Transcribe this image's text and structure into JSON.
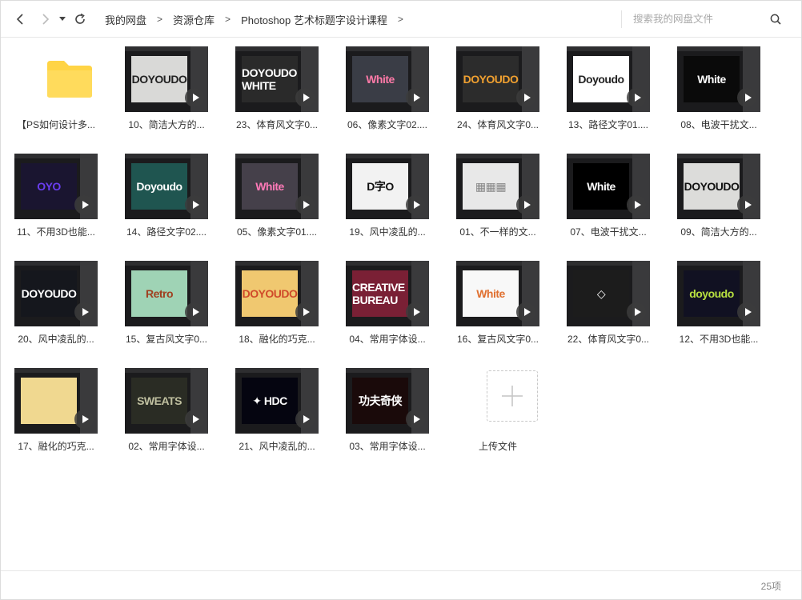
{
  "toolbar": {
    "back_icon": "chevron-left-icon",
    "forward_icon": "chevron-right-icon",
    "history_icon": "caret-down-icon",
    "refresh_icon": "refresh-icon",
    "breadcrumbs": [
      "我的网盘",
      "资源仓库",
      "Photoshop 艺术标题字设计课程"
    ],
    "separator": ">",
    "search_placeholder": "搜索我的网盘文件",
    "search_icon": "search-icon"
  },
  "files": [
    {
      "name": "【PS如何设计多...",
      "kind": "folder",
      "color": "#FFD445"
    },
    {
      "name": "10、简洁大方的...",
      "kind": "video",
      "thumb_text": "DOYOUDO",
      "text_color": "#222222",
      "bg": "#d9d9d7"
    },
    {
      "name": "23、体育风文字0...",
      "kind": "video",
      "thumb_text": "DOYOUDO WHITE",
      "text_color": "#ffffff",
      "bg": "#2a2a2a"
    },
    {
      "name": "06、像素文字02....",
      "kind": "video",
      "thumb_text": "White",
      "text_color": "#ff7aa8",
      "bg": "#3a3d46"
    },
    {
      "name": "24、体育风文字0...",
      "kind": "video",
      "thumb_text": "DOYOUDO",
      "text_color": "#f0a030",
      "bg": "#2c2c2c"
    },
    {
      "name": "13、路径文字01....",
      "kind": "video",
      "thumb_text": "Doyoudo",
      "text_color": "#222222",
      "bg": "#ffffff"
    },
    {
      "name": "08、电波干扰文...",
      "kind": "video",
      "thumb_text": "White",
      "text_color": "#ffffff",
      "bg": "#0a0a0a"
    },
    {
      "name": "11、不用3D也能...",
      "kind": "video",
      "thumb_text": "OYO",
      "text_color": "#6a3df0",
      "bg": "#1a1530"
    },
    {
      "name": "14、路径文字02....",
      "kind": "video",
      "thumb_text": "Doyoudo",
      "text_color": "#ffffff",
      "bg": "#1f5550"
    },
    {
      "name": "05、像素文字01....",
      "kind": "video",
      "thumb_text": "White",
      "text_color": "#ff7ab8",
      "bg": "#45404a"
    },
    {
      "name": "19、风中凌乱的...",
      "kind": "video",
      "thumb_text": "D字O",
      "text_color": "#111111",
      "bg": "#f2f2f2"
    },
    {
      "name": "01、不一样的文...",
      "kind": "video",
      "thumb_text": "▦▦▦",
      "text_color": "#888888",
      "bg": "#e8e8e8"
    },
    {
      "name": "07、电波干扰文...",
      "kind": "video",
      "thumb_text": "White",
      "text_color": "#ffffff",
      "bg": "#000000"
    },
    {
      "name": "09、简洁大方的...",
      "kind": "video",
      "thumb_text": "DOYOUDO",
      "text_color": "#111111",
      "bg": "#dcdcda"
    },
    {
      "name": "20、风中凌乱的...",
      "kind": "video",
      "thumb_text": "DOYOUDO",
      "text_color": "#ffffff",
      "bg": "#15171d"
    },
    {
      "name": "15、复古风文字0...",
      "kind": "video",
      "thumb_text": "Retro",
      "text_color": "#a04020",
      "bg": "#9fd3b5"
    },
    {
      "name": "18、融化的巧克...",
      "kind": "video",
      "thumb_text": "DOYOUDO",
      "text_color": "#d04a2a",
      "bg": "#f0c870"
    },
    {
      "name": "04、常用字体设...",
      "kind": "video",
      "thumb_text": "CREATIVE BUREAU",
      "text_color": "#ffffff",
      "bg": "#7a2035"
    },
    {
      "name": "16、复古风文字0...",
      "kind": "video",
      "thumb_text": "White",
      "text_color": "#e07030",
      "bg": "#f8f8f8"
    },
    {
      "name": "22、体育风文字0...",
      "kind": "video",
      "thumb_text": "◇",
      "text_color": "#ffffff",
      "bg": "#1c1c1c"
    },
    {
      "name": "12、不用3D也能...",
      "kind": "video",
      "thumb_text": "doyoudo",
      "text_color": "#b8e040",
      "bg": "#111122"
    },
    {
      "name": "17、融化的巧克...",
      "kind": "video",
      "thumb_text": "",
      "text_color": "#000000",
      "bg": "#f0d890"
    },
    {
      "name": "02、常用字体设...",
      "kind": "video",
      "thumb_text": "SWEATS",
      "text_color": "#c0c0a0",
      "bg": "#2a2c24"
    },
    {
      "name": "21、风中凌乱的...",
      "kind": "video",
      "thumb_text": "✦ HDC",
      "text_color": "#ffffff",
      "bg": "#050510"
    },
    {
      "name": "03、常用字体设...",
      "kind": "video",
      "thumb_text": "功夫奇侠",
      "text_color": "#ffffff",
      "bg": "#1a0a0a"
    },
    {
      "name": "上传文件",
      "kind": "upload",
      "icon": "plus-icon"
    }
  ],
  "status": {
    "count_label": "25项"
  }
}
